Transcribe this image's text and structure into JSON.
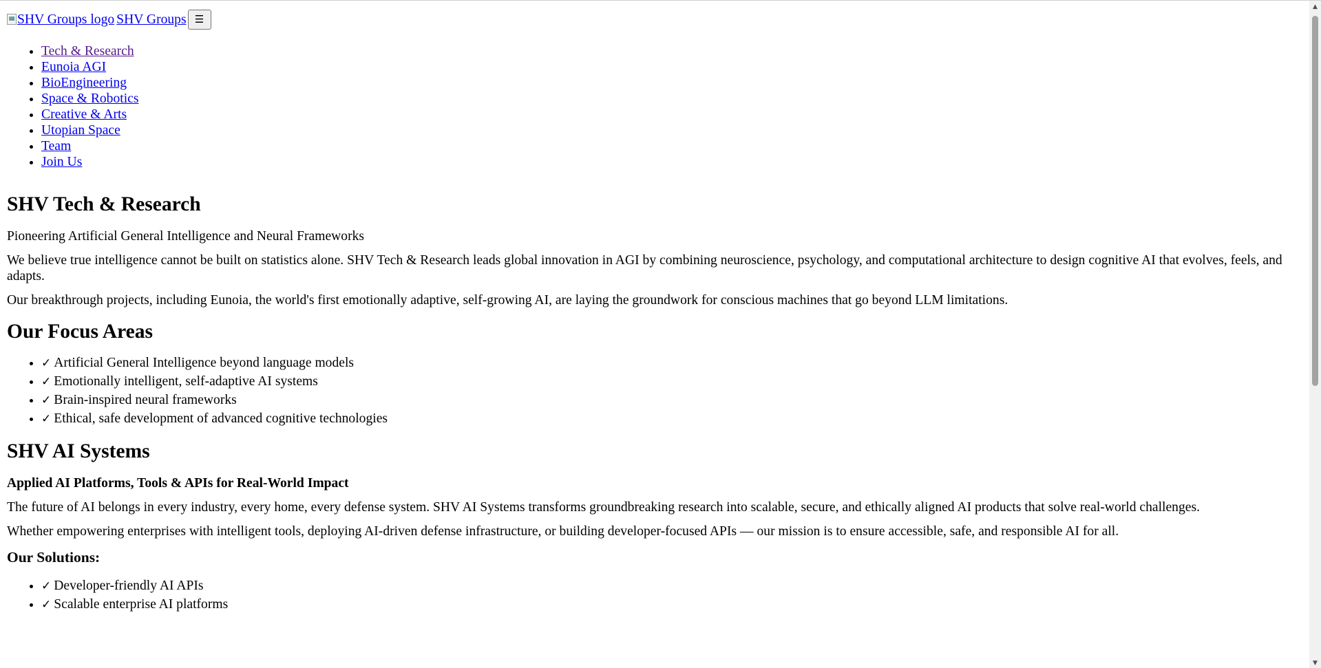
{
  "header": {
    "logo_alt": "SHV Groups logo",
    "brand_name": "SHV Groups",
    "menu_toggle_label": "☰"
  },
  "nav": {
    "items": [
      {
        "label": "Tech & Research",
        "visited": true
      },
      {
        "label": "Eunoia AGI"
      },
      {
        "label": "BioEngineering"
      },
      {
        "label": "Space & Robotics"
      },
      {
        "label": "Creative & Arts"
      },
      {
        "label": "Utopian Space"
      },
      {
        "label": "Team"
      },
      {
        "label": "Join Us"
      }
    ]
  },
  "tech_research": {
    "title": "SHV Tech & Research",
    "tagline": "Pioneering Artificial General Intelligence and Neural Frameworks",
    "paragraph1": "We believe true intelligence cannot be built on statistics alone. SHV Tech & Research leads global innovation in AGI by combining neuroscience, psychology, and computational architecture to design cognitive AI that evolves, feels, and adapts.",
    "paragraph2": "Our breakthrough projects, including Eunoia, the world's first emotionally adaptive, self-growing AI, are laying the groundwork for conscious machines that go beyond LLM limitations."
  },
  "focus_areas": {
    "title": "Our Focus Areas",
    "check_glyph": "✓",
    "items": [
      "Artificial General Intelligence beyond language models",
      "Emotionally intelligent, self-adaptive AI systems",
      "Brain-inspired neural frameworks",
      "Ethical, safe development of advanced cognitive technologies"
    ]
  },
  "ai_systems": {
    "title": "SHV AI Systems",
    "subtitle": "Applied AI Platforms, Tools & APIs for Real-World Impact",
    "paragraph1": "The future of AI belongs in every industry, every home, every defense system. SHV AI Systems transforms groundbreaking research into scalable, secure, and ethically aligned AI products that solve real-world challenges.",
    "paragraph2": "Whether empowering enterprises with intelligent tools, deploying AI-driven defense infrastructure, or building developer-focused APIs — our mission is to ensure accessible, safe, and responsible AI for all.",
    "solutions_title": "Our Solutions:",
    "solutions": [
      "Developer-friendly AI APIs",
      "Scalable enterprise AI platforms"
    ]
  },
  "scrollbar": {
    "up_glyph": "▲",
    "down_glyph": "▼"
  },
  "colors": {
    "link": "#0000ee",
    "visited_link": "#551a8b",
    "text": "#000000",
    "background": "#ffffff"
  }
}
